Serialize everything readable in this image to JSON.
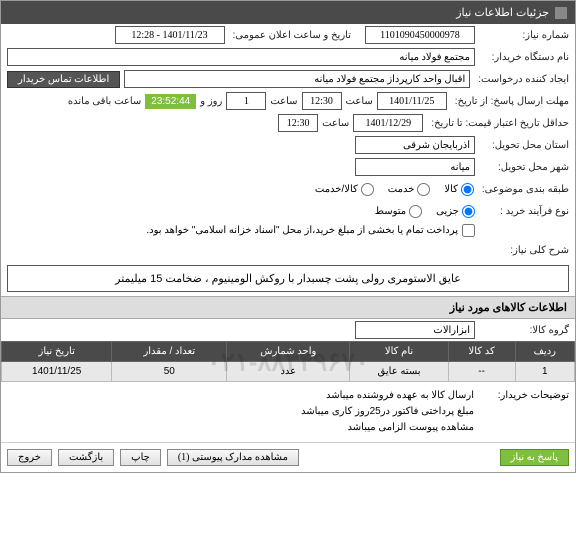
{
  "header": {
    "title": "جزئیات اطلاعات نیاز"
  },
  "fields": {
    "need_no_label": "شماره نیاز:",
    "need_no": "1101090450000978",
    "announce_label": "تاریخ و ساعت اعلان عمومی:",
    "announce": "1401/11/23 - 12:28",
    "buyer_label": "نام دستگاه خریدار:",
    "buyer": "مجتمع فولاد میانه",
    "requester_label": "ایجاد کننده درخواست:",
    "requester": "اقبال واحد کارپرداز مجتمع فولاد میانه",
    "contact_btn": "اطلاعات تماس خریدار",
    "deadline_label": "مهلت ارسال پاسخ: از تاریخ:",
    "deadline_date": "1401/11/25",
    "time_label": "ساعت",
    "deadline_time": "12:30",
    "days_label": "روز و",
    "days": "1",
    "remaining_time": "23:52:44",
    "remaining_label": "ساعت باقی مانده",
    "validity_label": "حداقل تاریخ اعتبار قیمت: تا تاریخ:",
    "validity_date": "1401/12/29",
    "validity_time": "12:30",
    "province_label": "استان محل تحویل:",
    "province": "آذربایجان شرقی",
    "city_label": "شهر محل تحویل:",
    "city": "میانه",
    "category_label": "طبقه بندی موضوعی:",
    "cat_kala": "کالا",
    "cat_khedmat": "خدمت",
    "cat_both": "کالا/خدمت",
    "process_label": "نوع فرآیند خرید :",
    "proc_partial": "جزیی",
    "proc_medium": "متوسط",
    "pay_note": "پرداخت تمام یا بخشی از مبلغ خرید،از محل \"اسناد خزانه اسلامی\" خواهد بود.",
    "need_desc_label": "شرح کلی نیاز:",
    "need_desc": "عایق الاستومری رولی پشت چسبدار با روکش الومینیوم ، ضخامت 15 میلیمتر"
  },
  "items_header": "اطلاعات کالاهای مورد نیاز",
  "group_label": "گروه کالا:",
  "group_value": "ابزارآلات",
  "table": {
    "headers": [
      "ردیف",
      "کد کالا",
      "نام کالا",
      "واحد شمارش",
      "تعداد / مقدار",
      "تاریخ نیاز"
    ],
    "rows": [
      {
        "c0": "1",
        "c1": "--",
        "c2": "بسته عایق",
        "c3": "عدد",
        "c4": "50",
        "c5": "1401/11/25"
      }
    ]
  },
  "buyer_notes_label": "توضیحات خریدار:",
  "buyer_notes": "ارسال کالا به عهده فروشنده میباشد\nمبلغ پرداختی فاکتور در25روز کاری میباشد\nمشاهده پیوست الزامی میباشد",
  "watermark": "۰۲۱-۸۸۳۴۹۶۷۰",
  "footer": {
    "respond": "پاسخ به نیاز",
    "attachments": "مشاهده مدارک پیوستی (1)",
    "print": "چاپ",
    "back": "بازگشت",
    "exit": "خروج"
  }
}
